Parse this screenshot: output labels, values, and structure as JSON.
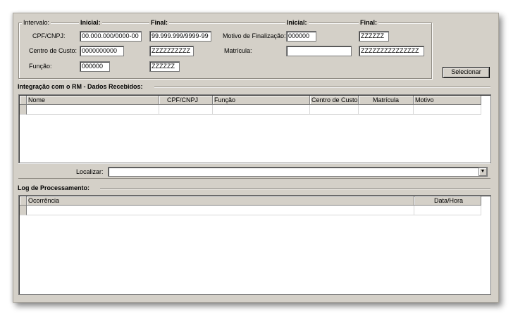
{
  "filter": {
    "group_label": "Intervalo:",
    "col_inicial": "Inicial:",
    "col_final": "Final:",
    "col_inicial_right": "Inicial:",
    "col_final_right": "Final:",
    "cpf_label": "CPF/CNPJ:",
    "cpf_inicial": "00.000.000/0000-00",
    "cpf_final": "99.999.999/9999-99",
    "centro_label": "Centro de Custo:",
    "centro_inicial": "0000000000",
    "centro_final": "ZZZZZZZZZZ",
    "funcao_label": "Função:",
    "funcao_inicial": "000000",
    "funcao_final": "ZZZZZZ",
    "motivo_label": "Motivo de Finalização:",
    "motivo_inicial": "000000",
    "motivo_final": "ZZZZZZ",
    "matricula_label": "Matrícula:",
    "matricula_inicial": "",
    "matricula_final": "ZZZZZZZZZZZZZZZ"
  },
  "select_button": "Selecionar",
  "integracao": {
    "title": "Integração com o RM - Dados Recebidos:",
    "columns": [
      "Nome",
      "CPF/CNPJ",
      "Função",
      "Centro de Custo",
      "Matrícula",
      "Motivo"
    ]
  },
  "localizar": {
    "label": "Localizar:",
    "value": ""
  },
  "log": {
    "title": "Log de Processamento:",
    "columns": [
      "Ocorrência",
      "Data/Hora"
    ]
  }
}
